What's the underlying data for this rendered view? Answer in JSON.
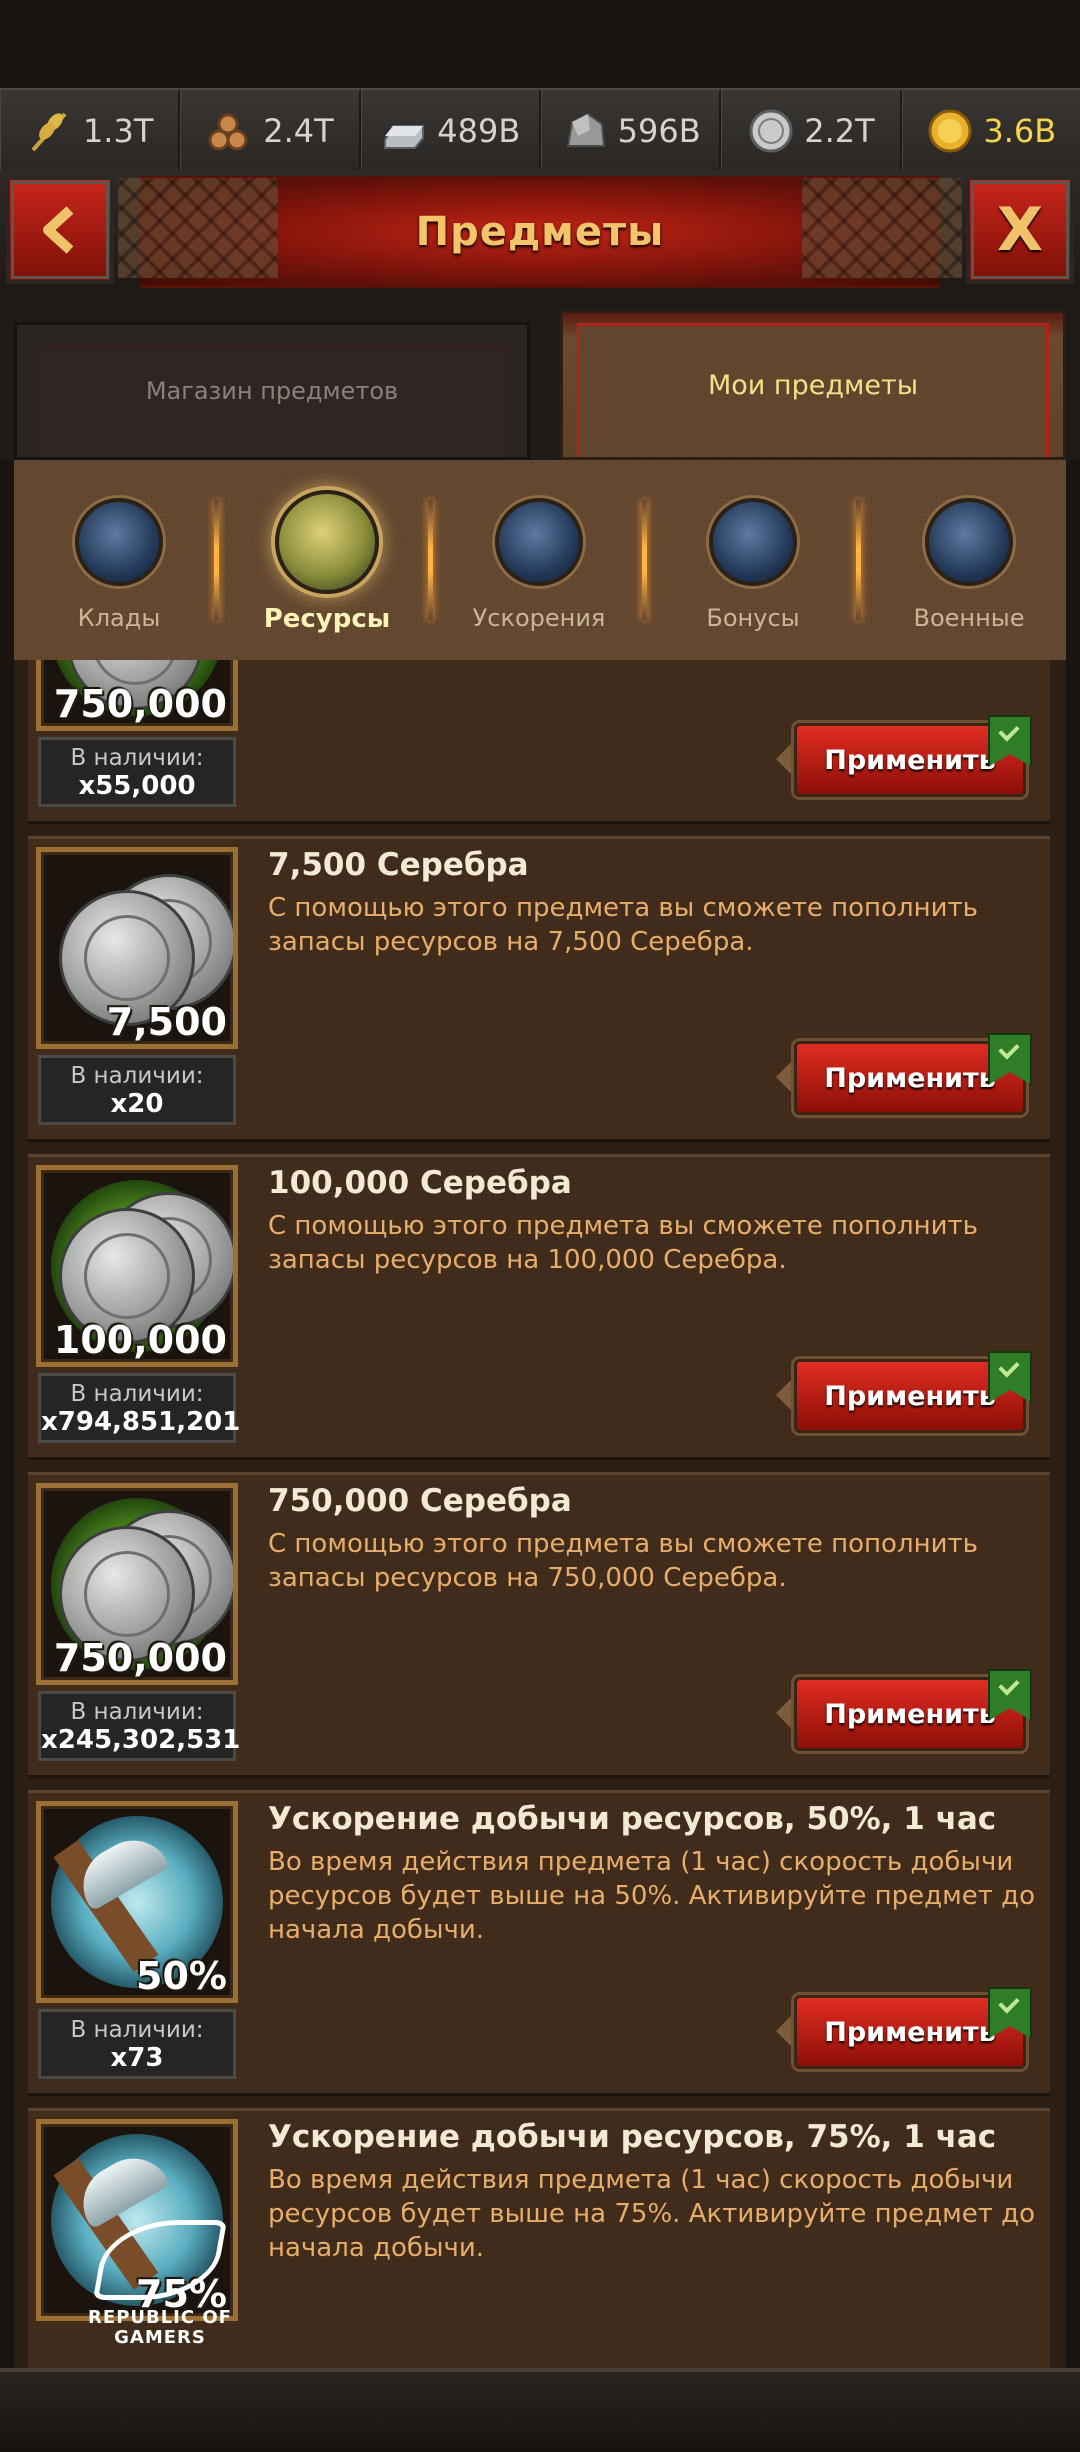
{
  "resources": [
    {
      "icon": "wheat-icon",
      "value": "1.3T"
    },
    {
      "icon": "logs-icon",
      "value": "2.4T"
    },
    {
      "icon": "iron-ingot-icon",
      "value": "489B"
    },
    {
      "icon": "stone-icon",
      "value": "596B"
    },
    {
      "icon": "silver-coin-icon",
      "value": "2.2T"
    },
    {
      "icon": "gold-coin-icon",
      "value": "3.6B"
    }
  ],
  "header": {
    "title": "Предметы",
    "back_label": "<",
    "close_label": "X"
  },
  "tabs": {
    "shop": "Магазин предметов",
    "mine": "Мои предметы"
  },
  "categories": [
    {
      "label": "Клады",
      "icon": "chest-icon"
    },
    {
      "label": "Ресурсы",
      "icon": "resources-icon",
      "active": true
    },
    {
      "label": "Ускорения",
      "icon": "speedup-icon"
    },
    {
      "label": "Бонусы",
      "icon": "bonus-bag-icon"
    },
    {
      "label": "Военные",
      "icon": "swords-icon"
    }
  ],
  "items": [
    {
      "amount": "750,000",
      "stock_label": "В наличии:",
      "stock": "x55,000",
      "apply": "Применить"
    },
    {
      "name": "7,500 Серебра",
      "desc": "С помощью этого предмета вы сможете пополнить запасы ресурсов на 7,500 Серебра.",
      "amount": "7,500",
      "stock_label": "В наличии:",
      "stock": "x20",
      "apply": "Применить"
    },
    {
      "name": "100,000 Серебра",
      "desc": "С помощью этого предмета вы сможете пополнить запасы ресурсов на 100,000 Серебра.",
      "amount": "100,000",
      "stock_label": "В наличии:",
      "stock": "x794,851,201",
      "apply": "Применить"
    },
    {
      "name": "750,000 Серебра",
      "desc": "С помощью этого предмета вы сможете пополнить запасы ресурсов на 750,000 Серебра.",
      "amount": "750,000",
      "stock_label": "В наличии:",
      "stock": "x245,302,531",
      "apply": "Применить"
    },
    {
      "name": "Ускорение добычи ресурсов, 50%, 1 час",
      "desc": "Во время действия предмета (1 час) скорость добычи ресурсов будет выше на 50%. Активируйте предмет до начала добычи.",
      "amount": "50%",
      "stock_label": "В наличии:",
      "stock": "x73",
      "apply": "Применить"
    },
    {
      "name": "Ускорение добычи ресурсов, 75%, 1 час",
      "desc": "Во время действия предмета (1 час) скорость добычи ресурсов будет выше на 75%. Активируйте предмет до начала добычи.",
      "amount": "75%"
    }
  ],
  "watermark": "REPUBLIC OF GAMERS"
}
